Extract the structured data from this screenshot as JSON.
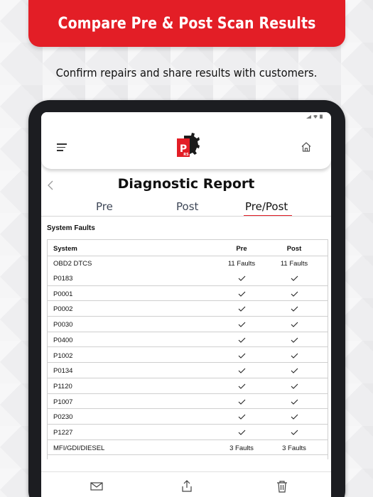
{
  "banner": {
    "title": "Compare Pre & Post Scan Results"
  },
  "subtitle": "Confirm repairs and share results with customers.",
  "app": {
    "header": {
      "menu_icon": "hamburger-menu-icon",
      "logo_icon": "gear-logo-icon",
      "home_icon": "home-icon"
    },
    "report_title": "Diagnostic Report",
    "tabs": [
      {
        "label": "Pre",
        "active": false
      },
      {
        "label": "Post",
        "active": false
      },
      {
        "label": "Pre/Post",
        "active": true
      }
    ],
    "section_label": "System Faults",
    "table": {
      "columns": [
        "System",
        "Pre",
        "Post"
      ],
      "rows": [
        {
          "system": "OBD2 DTCS",
          "pre": "11 Faults",
          "post": "11 Faults",
          "kind": "group"
        },
        {
          "system": "P0183",
          "pre": "check",
          "post": "check"
        },
        {
          "system": "P0001",
          "pre": "check",
          "post": "check"
        },
        {
          "system": "P0002",
          "pre": "check",
          "post": "check"
        },
        {
          "system": "P0030",
          "pre": "check",
          "post": "check"
        },
        {
          "system": "P0400",
          "pre": "check",
          "post": "check"
        },
        {
          "system": "P1002",
          "pre": "check",
          "post": "check"
        },
        {
          "system": "P0134",
          "pre": "check",
          "post": "check"
        },
        {
          "system": "P1120",
          "pre": "check",
          "post": "check"
        },
        {
          "system": "P1007",
          "pre": "check",
          "post": "check"
        },
        {
          "system": "P0230",
          "pre": "check",
          "post": "check"
        },
        {
          "system": "P1227",
          "pre": "check",
          "post": "check"
        },
        {
          "system": "MFI/GDI/DIESEL",
          "pre": "3 Faults",
          "post": "3 Faults",
          "kind": "group"
        }
      ]
    },
    "toolbar": {
      "icons": [
        "mail-icon",
        "share-icon",
        "trash-icon"
      ]
    }
  },
  "colors": {
    "accent": "#e31e26",
    "frame": "#1c1d21",
    "tab_text": "#3e4757"
  }
}
